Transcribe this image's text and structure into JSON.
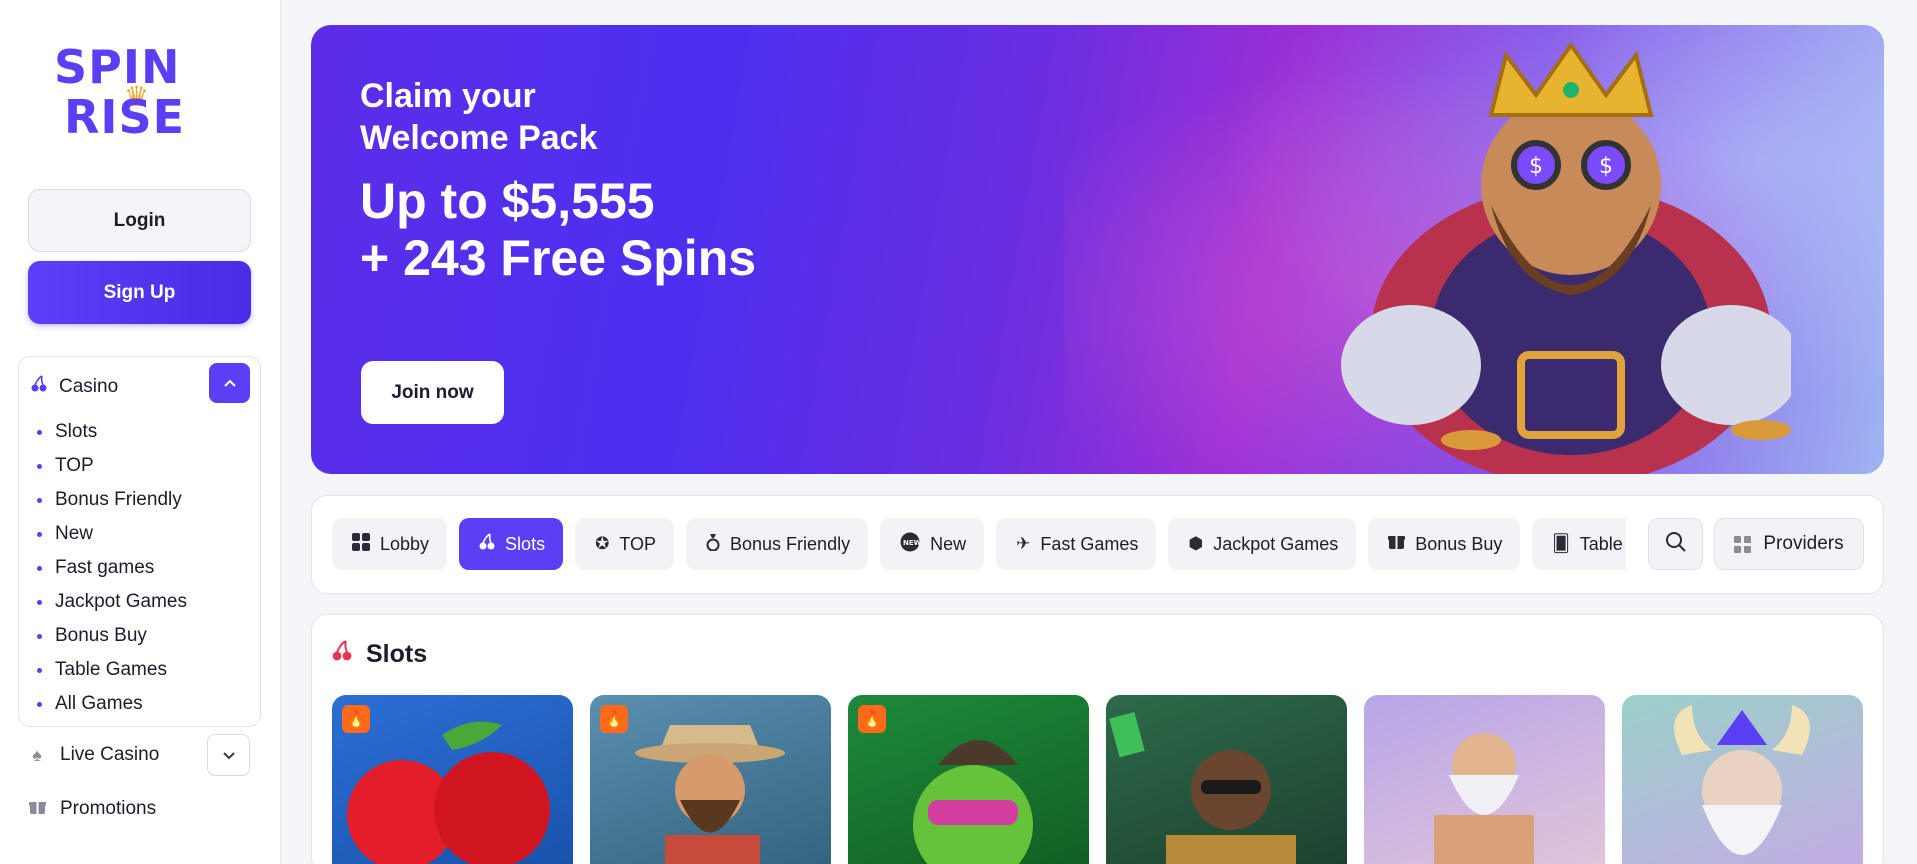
{
  "brand": {
    "line1": "SPIN",
    "line2": "RISE"
  },
  "auth": {
    "login_label": "Login",
    "signup_label": "Sign Up"
  },
  "sidebar": {
    "casino_label": "Casino",
    "casino_items": [
      "Slots",
      "TOP",
      "Bonus Friendly",
      "New",
      "Fast games",
      "Jackpot Games",
      "Bonus Buy",
      "Table Games",
      "All Games"
    ],
    "live_casino_label": "Live Casino",
    "promotions_label": "Promotions"
  },
  "hero": {
    "line1": "Claim your",
    "line2": "Welcome Pack",
    "offer1": "Up to $5,555",
    "offer2": "+ 243 Free Spins",
    "cta_label": "Join now"
  },
  "categories": [
    {
      "label": "Lobby",
      "icon": "grid-icon",
      "active": false
    },
    {
      "label": "Slots",
      "icon": "cherry-icon",
      "active": true
    },
    {
      "label": "TOP",
      "icon": "medal-icon",
      "active": false
    },
    {
      "label": "Bonus Friendly",
      "icon": "bag-icon",
      "active": false
    },
    {
      "label": "New",
      "icon": "new-badge-icon",
      "active": false
    },
    {
      "label": "Fast Games",
      "icon": "plane-icon",
      "active": false
    },
    {
      "label": "Jackpot Games",
      "icon": "gem-icon",
      "active": false
    },
    {
      "label": "Bonus Buy",
      "icon": "gift-icon",
      "active": false
    },
    {
      "label": "Table Games",
      "icon": "cards-icon",
      "active": false
    }
  ],
  "providers_label": "Providers",
  "slots_section": {
    "title": "Slots"
  },
  "colors": {
    "accent": "#5b3ff5",
    "hot_badge": "#ff6a1a"
  }
}
